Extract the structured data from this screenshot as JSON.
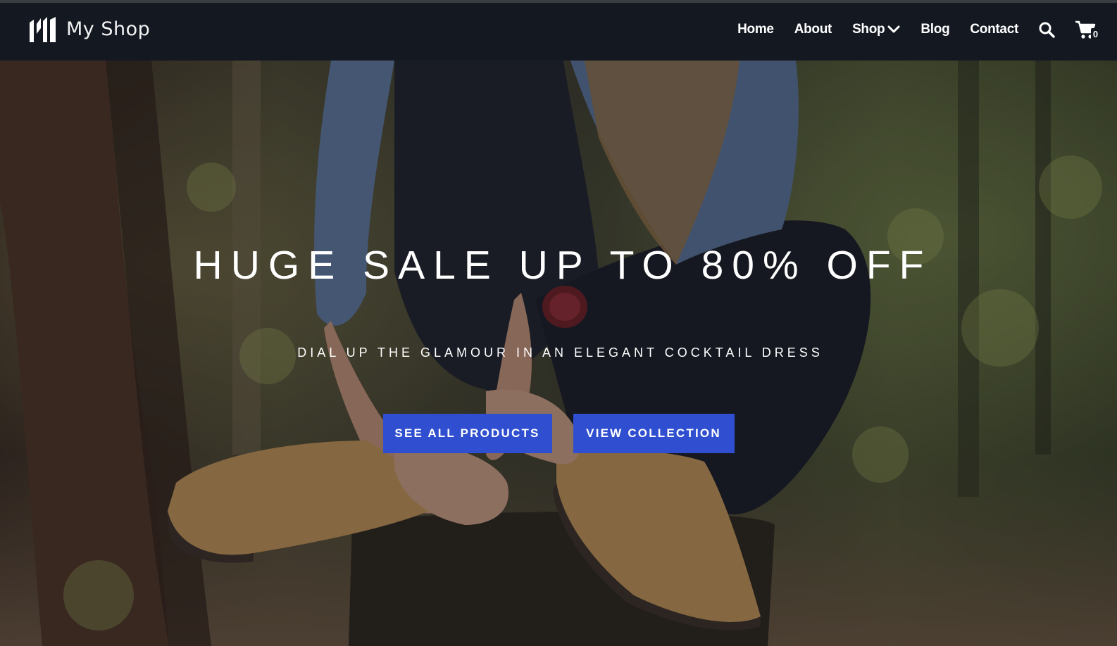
{
  "brand": {
    "name": "My Shop"
  },
  "nav": {
    "items": [
      {
        "label": "Home"
      },
      {
        "label": "About"
      },
      {
        "label": "Shop",
        "has_dropdown": true
      },
      {
        "label": "Blog"
      },
      {
        "label": "Contact"
      }
    ],
    "search_icon": "search-icon",
    "cart": {
      "icon": "cart-icon",
      "count": "0"
    }
  },
  "hero": {
    "title": "HUGE SALE UP TO 80% OFF",
    "subtitle": "DIAL UP THE GLAMOUR IN AN ELEGANT COCKTAIL DRESS",
    "buttons": [
      {
        "label": "SEE ALL PRODUCTS"
      },
      {
        "label": "VIEW COLLECTION"
      }
    ]
  },
  "colors": {
    "header_bg": "#141821",
    "button_bg": "#2f4fd0",
    "text": "#ffffff"
  }
}
